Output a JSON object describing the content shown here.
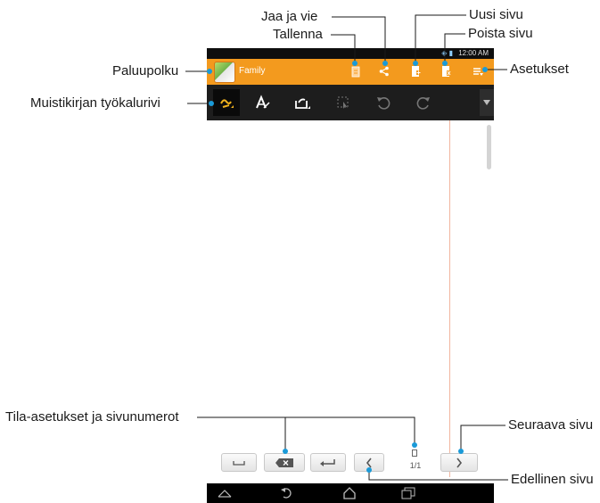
{
  "annotations": {
    "jaa_ja_vie": "Jaa ja vie",
    "uusi_sivu": "Uusi sivu",
    "tallenna": "Tallenna",
    "poista_sivu": "Poista sivu",
    "paluupolku": "Paluupolku",
    "asetukset": "Asetukset",
    "tyokalurivi": "Muistikirjan työkalurivi",
    "tila_asetukset": "Tila-asetukset ja sivunumerot",
    "seuraava_sivu": "Seuraava sivu",
    "edellinen_sivu": "Edellinen sivu"
  },
  "status_bar": {
    "time": "12:00 AM"
  },
  "action_bar": {
    "notebook_title": "Family"
  },
  "toolbar": {
    "tools": [
      "pen-icon",
      "text-icon",
      "insert-icon",
      "select-icon",
      "undo-icon",
      "redo-icon"
    ],
    "more": "more-icon"
  },
  "page": {
    "page_number": "1/1"
  },
  "colors": {
    "accent": "#f39a1e",
    "toolbar": "#1d1d1d",
    "active_tool": "#f0b21e"
  }
}
